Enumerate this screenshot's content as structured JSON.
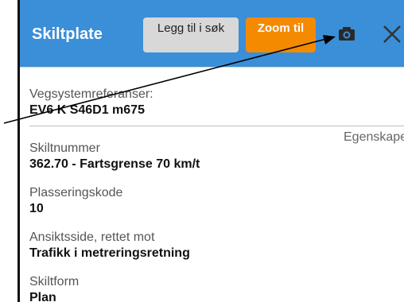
{
  "panel": {
    "title": "Skiltplate",
    "buttons": {
      "add_to_search": "Legg til i søk",
      "zoom_to": "Zoom til"
    },
    "icons": {
      "camera": "camera-icon",
      "close": "close-icon"
    },
    "colors": {
      "header": "#3a8fd8",
      "zoom": "#f48a00",
      "search_btn": "#d8d8d8"
    }
  },
  "reference": {
    "label": "Vegsystemreferanser:",
    "value": "EV6 K S46D1 m675"
  },
  "section_tab": "Egenskaper",
  "fields": [
    {
      "label": "Skiltnummer",
      "value": "362.70 - Fartsgrense 70 km/t"
    },
    {
      "label": "Plasseringskode",
      "value": "10"
    },
    {
      "label": "Ansiktsside, rettet mot",
      "value": "Trafikk i metreringsretning"
    },
    {
      "label": "Skiltform",
      "value": "Plan"
    }
  ]
}
